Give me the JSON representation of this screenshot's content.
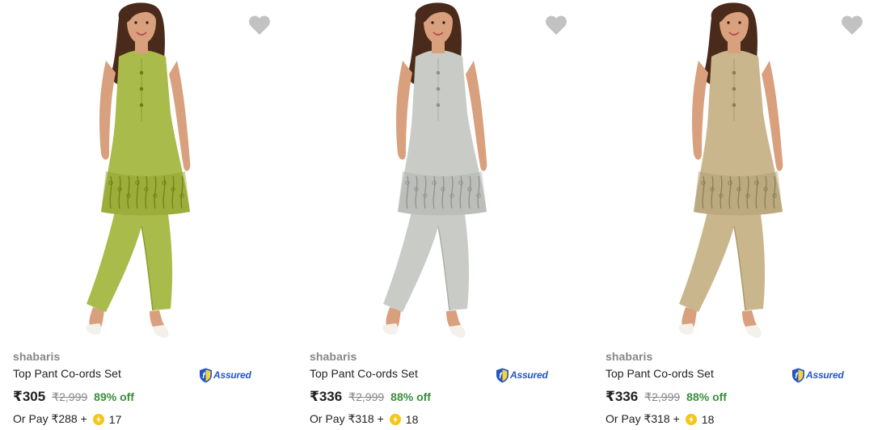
{
  "colors": {
    "wishlist_heart": "#c2c2c2",
    "brand_text": "#878787",
    "discount_green": "#388e3c",
    "assured_blue": "#2455c2",
    "coin_yellow": "#f5c518"
  },
  "icons": {
    "wishlist": "heart-icon",
    "assured": "assured-shield-icon",
    "coin": "supercoin-icon"
  },
  "products": [
    {
      "image_desc_color": "#a9bb4a",
      "brand": "shabaris",
      "title": "Top Pant Co-ords Set",
      "assured_label": "Assured",
      "price": "₹305",
      "mrp": "₹2,999",
      "discount": "89% off",
      "or_pay_label": "Or Pay ₹288 +",
      "coins": "17"
    },
    {
      "image_desc_color": "#c9ccc6",
      "brand": "shabaris",
      "title": "Top Pant Co-ords Set",
      "assured_label": "Assured",
      "price": "₹336",
      "mrp": "₹2,999",
      "discount": "88% off",
      "or_pay_label": "Or Pay ₹318 +",
      "coins": "18"
    },
    {
      "image_desc_color": "#c9b68c",
      "brand": "shabaris",
      "title": "Top Pant Co-ords Set",
      "assured_label": "Assured",
      "price": "₹336",
      "mrp": "₹2,999",
      "discount": "88% off",
      "or_pay_label": "Or Pay ₹318 +",
      "coins": "18"
    }
  ]
}
